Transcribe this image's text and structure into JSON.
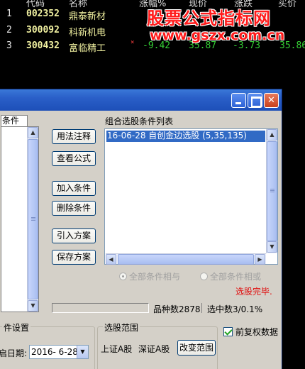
{
  "header": {
    "col_code": "代码",
    "col_name": "名称",
    "col_c1": "涨幅%",
    "col_c2": "现价",
    "col_c3": "涨跌",
    "col_c4": "买价"
  },
  "stocks": [
    {
      "idx": "1",
      "code": "002352",
      "name": "鼎泰新材",
      "mark": "",
      "v1": "",
      "v2": "",
      "v3": "",
      "v4": ""
    },
    {
      "idx": "2",
      "code": "300092",
      "name": "科新机电",
      "mark": "",
      "v1": "",
      "v2": "",
      "v3": "",
      "v4": ""
    },
    {
      "idx": "3",
      "code": "300432",
      "name": "富临精工",
      "mark": "×",
      "v1": "-9.42",
      "v2": "35.87",
      "v3": "-3.73",
      "v4": "35.86"
    }
  ],
  "watermark": {
    "line1": "股票公式指标网",
    "line2": "www.gszx.com.cn"
  },
  "window": {
    "left_tab": "条件",
    "buttons": [
      "用法注释",
      "查看公式",
      "加入条件",
      "删除条件",
      "引入方案",
      "保存方案"
    ],
    "list_caption": "组合选股条件列表",
    "list_items": [
      "16-06-28 自创金边选股 (5,35,135)"
    ],
    "radio_all_and": "全部条件相与",
    "radio_all_or": "全部条件相或",
    "status_done": "选股完毕.",
    "count_total": "品种数2878",
    "count_selected": "选中数3/0.1%",
    "group_date_title": "件设置",
    "date_label": "启日期:",
    "date_value": "2016- 6-28",
    "group_range_title": "选股范围",
    "market_sh": "上证A股",
    "market_sz": "深证A股",
    "change_range": "改变范围",
    "checkbox_label": "前复权数据"
  }
}
